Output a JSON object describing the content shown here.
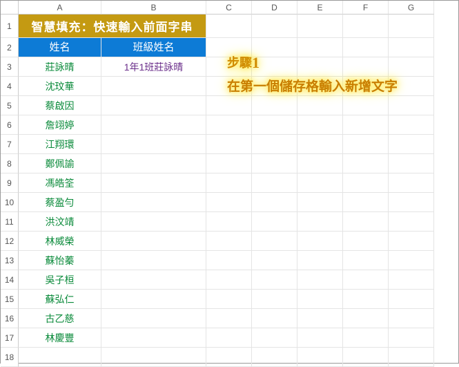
{
  "columns": [
    "A",
    "B",
    "C",
    "D",
    "E",
    "F",
    "G"
  ],
  "row_numbers": [
    1,
    2,
    3,
    4,
    5,
    6,
    7,
    8,
    9,
    10,
    11,
    12,
    13,
    14,
    15,
    16,
    17,
    18
  ],
  "title": "智慧填充：快速輸入前面字串",
  "headers": {
    "A": "姓名",
    "B": "班級姓名"
  },
  "names": [
    "莊詠晴",
    "沈玟華",
    "蔡啟因",
    "詹翊婷",
    "江翔環",
    "鄭佩諭",
    "馮皓筌",
    "蔡盈勻",
    "洪汶靖",
    "林威榮",
    "蘇怡蓁",
    "吳子桓",
    "蘇弘仁",
    "古乙慈",
    "林慶豐"
  ],
  "class_name_first": "1年1班莊詠晴",
  "annotation": {
    "step_prefix": "步驟",
    "step_number": "1",
    "description": "在第一個儲存格輸入新增文字"
  }
}
